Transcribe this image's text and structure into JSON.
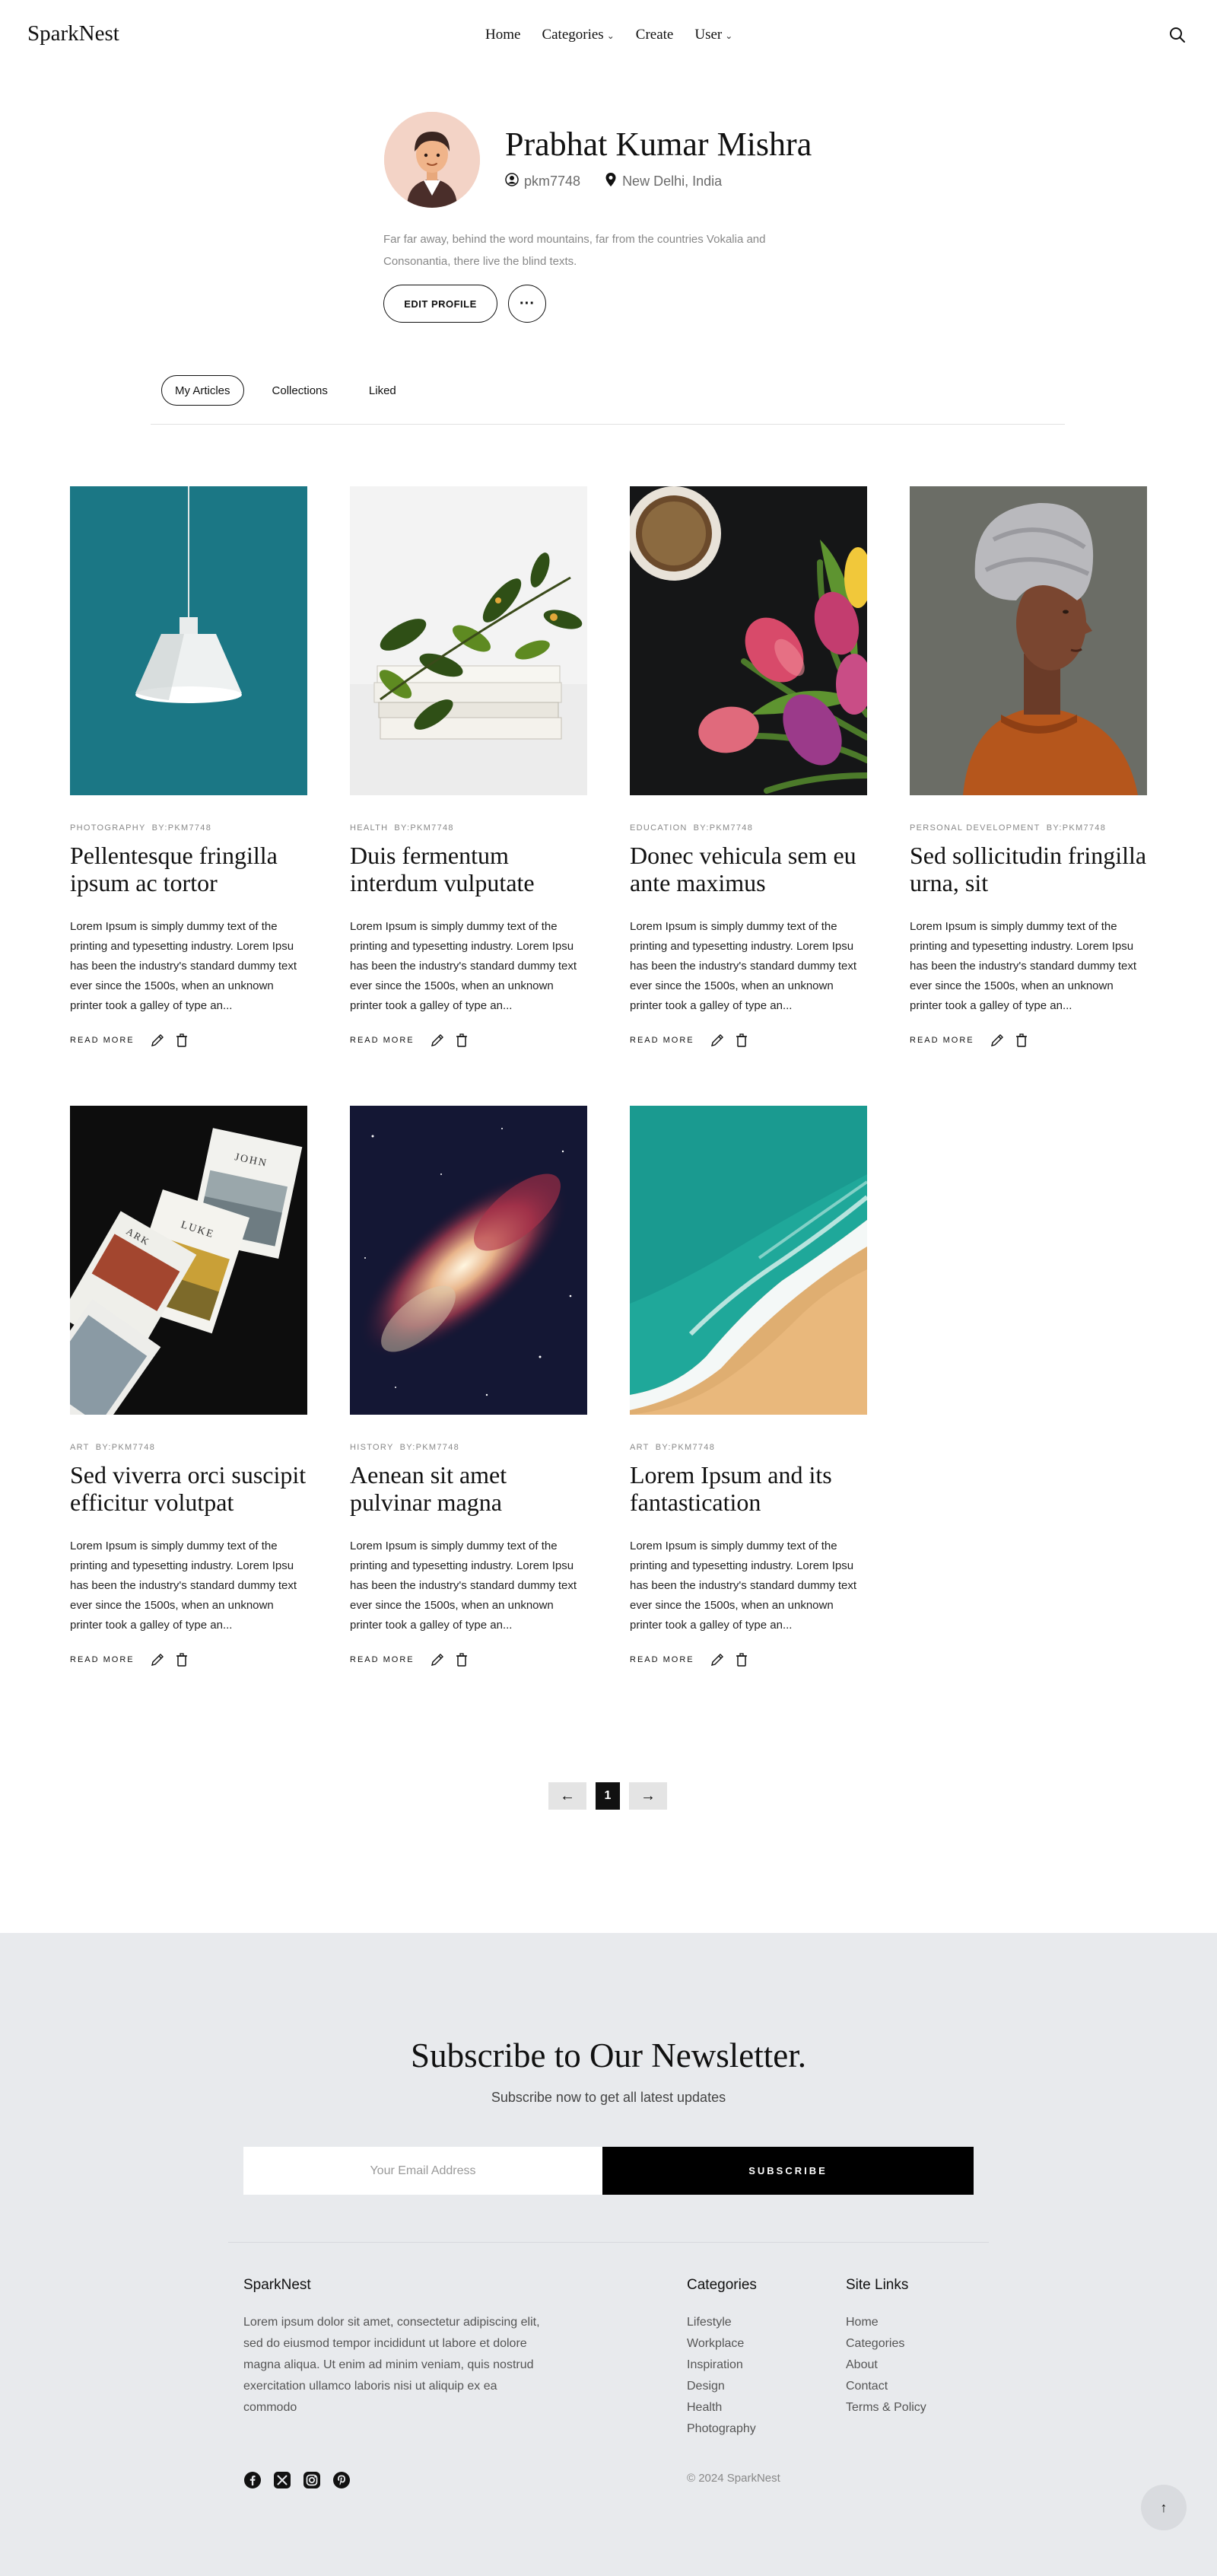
{
  "header": {
    "logo": "SparkNest",
    "nav": [
      {
        "label": "Home",
        "has_dropdown": false
      },
      {
        "label": "Categories",
        "has_dropdown": true
      },
      {
        "label": "Create",
        "has_dropdown": false
      },
      {
        "label": "User",
        "has_dropdown": true
      }
    ]
  },
  "profile": {
    "name": "Prabhat Kumar Mishra",
    "username": "pkm7748",
    "location": "New Delhi, India",
    "bio": "Far far away, behind the word mountains, far from the countries Vokalia and Consonantia, there live the blind texts.",
    "edit_label": "EDIT PROFILE",
    "more_label": "···"
  },
  "tabs": [
    {
      "label": "My Articles",
      "active": true
    },
    {
      "label": "Collections",
      "active": false
    },
    {
      "label": "Liked",
      "active": false
    }
  ],
  "articles": [
    {
      "category": "Photography",
      "by_label": "BY:",
      "author": "PKM7748",
      "title": "Pellentesque fringilla ipsum ac tortor",
      "excerpt": "Lorem Ipsum is simply dummy text of the printing and typesetting industry. Lorem Ipsu has been the industry's standard dummy text ever since the 1500s, when an unknown printer took a galley of type an...",
      "image": "lamp"
    },
    {
      "category": "Health",
      "by_label": "BY:",
      "author": "PKM7748",
      "title": "Duis fermentum interdum vulputate",
      "excerpt": "Lorem Ipsum is simply dummy text of the printing and typesetting industry. Lorem Ipsu has been the industry's standard dummy text ever since the 1500s, when an unknown printer took a galley of type an...",
      "image": "books-plant"
    },
    {
      "category": "Education",
      "by_label": "BY:",
      "author": "PKM7748",
      "title": "Donec vehicula sem eu ante maximus",
      "excerpt": "Lorem Ipsum is simply dummy text of the printing and typesetting industry. Lorem Ipsu has been the industry's standard dummy text ever since the 1500s, when an unknown printer took a galley of type an...",
      "image": "coffee-tulips"
    },
    {
      "category": "Personal Development",
      "by_label": "BY:",
      "author": "PKM7748",
      "title": "Sed sollicitudin fringilla urna, sit",
      "excerpt": "Lorem Ipsum is simply dummy text of the printing and typesetting industry. Lorem Ipsu has been the industry's standard dummy text ever since the 1500s, when an unknown printer took a galley of type an...",
      "image": "woman-portrait"
    },
    {
      "category": "Art",
      "by_label": "BY:",
      "author": "PKM7748",
      "title": "Sed viverra orci suscipit efficitur volutpat",
      "excerpt": "Lorem Ipsum is simply dummy text of the printing and typesetting industry. Lorem Ipsu has been the industry's standard dummy text ever since the 1500s, when an unknown printer took a galley of type an...",
      "image": "magazines",
      "mag_words": [
        "JOHN",
        "LUKE",
        "ARK"
      ]
    },
    {
      "category": "History",
      "by_label": "BY:",
      "author": "PKM7748",
      "title": "Aenean sit amet pulvinar magna",
      "excerpt": "Lorem Ipsum is simply dummy text of the printing and typesetting industry. Lorem Ipsu has been the industry's standard dummy text ever since the 1500s, when an unknown printer took a galley of type an...",
      "image": "galaxy"
    },
    {
      "category": "Art",
      "by_label": "BY:",
      "author": "PKM7748",
      "title": "Lorem Ipsum and its fantastication",
      "excerpt": "Lorem Ipsum is simply dummy text of the printing and typesetting industry. Lorem Ipsu has been the industry's standard dummy text ever since the 1500s, when an unknown printer took a galley of type an...",
      "image": "ocean-beach"
    }
  ],
  "read_more_label": "READ MORE",
  "pagination": {
    "prev": "←",
    "current": "1",
    "next": "→"
  },
  "newsletter": {
    "title": "Subscribe to Our Newsletter.",
    "subtitle": "Subscribe now to get all latest updates",
    "placeholder": "Your Email Address",
    "button": "SUBSCRIBE"
  },
  "footer": {
    "brand": "SparkNest",
    "description": "Lorem ipsum dolor sit amet, consectetur adipiscing elit, sed do eiusmod tempor incididunt ut labore et dolore magna aliqua. Ut enim ad minim veniam, quis nostrud exercitation ullamco laboris nisi ut aliquip ex ea commodo",
    "categories_title": "Categories",
    "categories": [
      "Lifestyle",
      "Workplace",
      "Inspiration",
      "Design",
      "Health",
      "Photography"
    ],
    "sitelinks_title": "Site Links",
    "sitelinks": [
      "Home",
      "Categories",
      "About",
      "Contact",
      "Terms & Policy"
    ],
    "socials": [
      "facebook-icon",
      "x-icon",
      "instagram-icon",
      "pinterest-icon"
    ],
    "copyright": "© 2024 SparkNest",
    "to_top": "↑"
  },
  "colors": {
    "accent": "#111111",
    "footer_bg": "#e8eaed",
    "muted": "#888888"
  }
}
